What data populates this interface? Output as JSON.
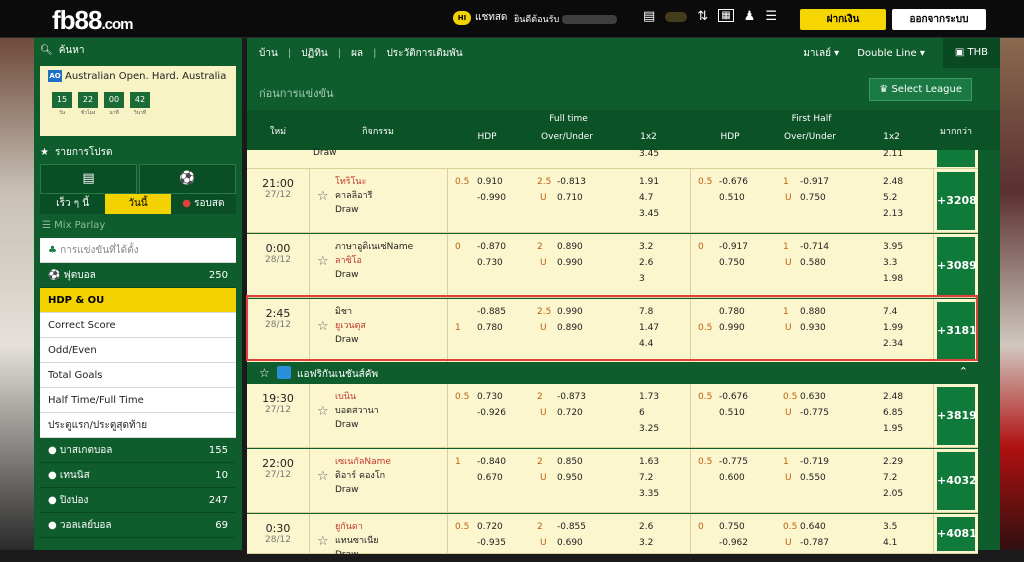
{
  "brand": {
    "logo_main": "fb88",
    "logo_suffix": ".com"
  },
  "topbar": {
    "chat_label": "แชทสด",
    "welcome": "ยินดีต้อนรับ",
    "deposit": "ฝากเงิน",
    "logout": "ออกจากระบบ"
  },
  "sidebar": {
    "search_label": "ค้นหา",
    "match": {
      "title": "Australian Open. Hard. Australia",
      "logo": "AO",
      "timer": [
        "15",
        "22",
        "00",
        "42"
      ],
      "timer_labels": [
        "วัน",
        "ชั่วโมง",
        "นาที",
        "วินาที"
      ]
    },
    "favorites_label": "รายการโปรด",
    "tabs": [
      "เร็ว ๆ นี้",
      "วันนี้",
      "รอบสด"
    ],
    "mix_parlay": "Mix Parlay",
    "pinned": "การแข่งขันที่ได้ตั้ง",
    "sports": [
      {
        "label": "ฟุตบอล",
        "count": "250"
      }
    ],
    "markets": [
      "HDP & OU",
      "Correct Score",
      "Odd/Even",
      "Total Goals",
      "Half Time/Full Time",
      "ประตูแรก/ประตูสุดท้าย"
    ],
    "sports2": [
      {
        "label": "บาสเกตบอล",
        "count": "155"
      },
      {
        "label": "เทนนิส",
        "count": "10"
      },
      {
        "label": "ปิงปอง",
        "count": "247"
      },
      {
        "label": "วอลเลย์บอล",
        "count": "69"
      }
    ]
  },
  "nav": {
    "items": [
      "บ้าน",
      "ปฏิทิน",
      "ผล",
      "ประวัติการเดิมพัน"
    ],
    "market": "มาเลย์",
    "line": "Double Line",
    "currency": "THB"
  },
  "sub": {
    "title": "ก่อนการแข่งขัน",
    "select_league": "Select League"
  },
  "thead": {
    "time": "ใหม่",
    "event": "กิจกรรม",
    "full_time": "Full time",
    "first_half": "First Half",
    "more": "มากกว่า",
    "hdp": "HDP",
    "ou": "Over/Under",
    "x12": "1x2"
  },
  "top_partial": {
    "team3": "Draw",
    "ft_1x2": "3.45",
    "fh_1x2": "2.11"
  },
  "section2": {
    "title": "แอฟริกันเนชันส์คัพ"
  },
  "colors": {
    "green": "#0f5d2d",
    "yellow": "#f2d200",
    "row_bg": "#fbf6cd",
    "highlight": "#e0413a"
  }
}
